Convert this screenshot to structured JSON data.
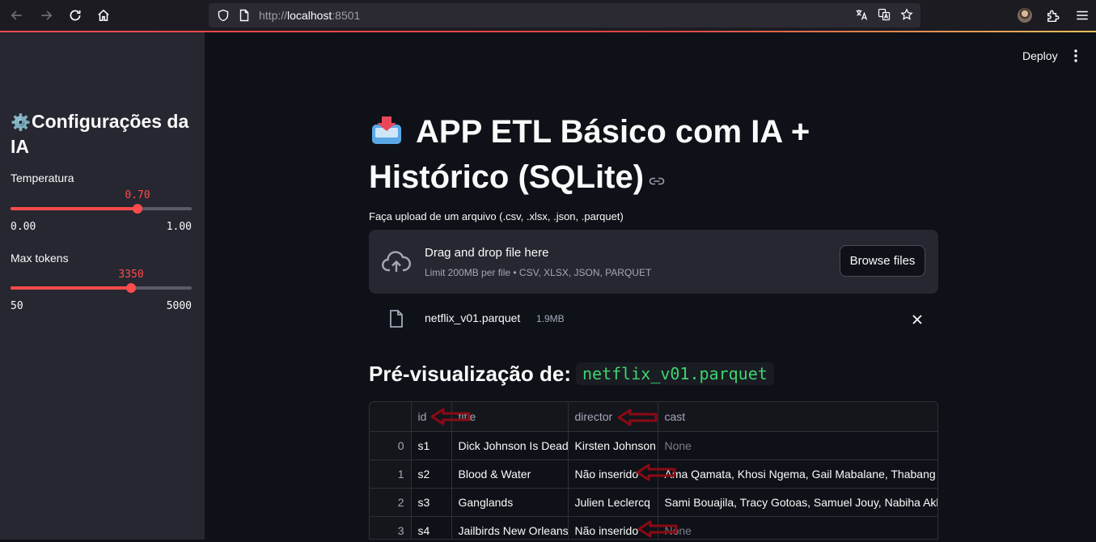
{
  "browser": {
    "url_prefix": "http://",
    "url_host": "localhost",
    "url_port": ":8501"
  },
  "sidebar": {
    "title": "Configurações da IA",
    "sliders": [
      {
        "label": "Temperatura",
        "value": "0.70",
        "min": "0.00",
        "max": "1.00",
        "fraction": 0.7
      },
      {
        "label": "Max tokens",
        "value": "3350",
        "min": "50",
        "max": "5000",
        "fraction": 0.6667
      }
    ]
  },
  "header": {
    "deploy_label": "Deploy"
  },
  "main": {
    "title": "APP ETL Básico com IA + Histórico (SQLite)",
    "upload_label": "Faça upload de um arquivo (.csv, .xlsx, .json, .parquet)",
    "dropzone_title": "Drag and drop file here",
    "dropzone_limit": "Limit 200MB per file • CSV, XLSX, JSON, PARQUET",
    "browse_label": "Browse files",
    "file_name": "netflix_v01.parquet",
    "file_size": "1.9MB",
    "preview_heading": "Pré-visualização de:",
    "preview_file": "netflix_v01.parquet"
  },
  "table": {
    "columns": [
      "",
      "id",
      "title",
      "director",
      "cast"
    ],
    "rows": [
      [
        "0",
        "s1",
        "Dick Johnson Is Dead",
        "Kirsten Johnson",
        "None"
      ],
      [
        "1",
        "s2",
        "Blood & Water",
        "Não inserido",
        "Ama Qamata, Khosi Ngema, Gail Mabalane, Thabang Molaba"
      ],
      [
        "2",
        "s3",
        "Ganglands",
        "Julien Leclercq",
        "Sami Bouajila, Tracy Gotoas, Samuel Jouy, Nabiha Akkari, Sofia"
      ],
      [
        "3",
        "s4",
        "Jailbirds New Orleans",
        "Não inserido",
        "None"
      ]
    ]
  },
  "colors": {
    "accent": "#ff4b4b",
    "sidebar_bg": "#262730",
    "main_bg": "#0e1117",
    "code_green": "#3dd56d",
    "annotation_arrow": "#8b0a14"
  }
}
